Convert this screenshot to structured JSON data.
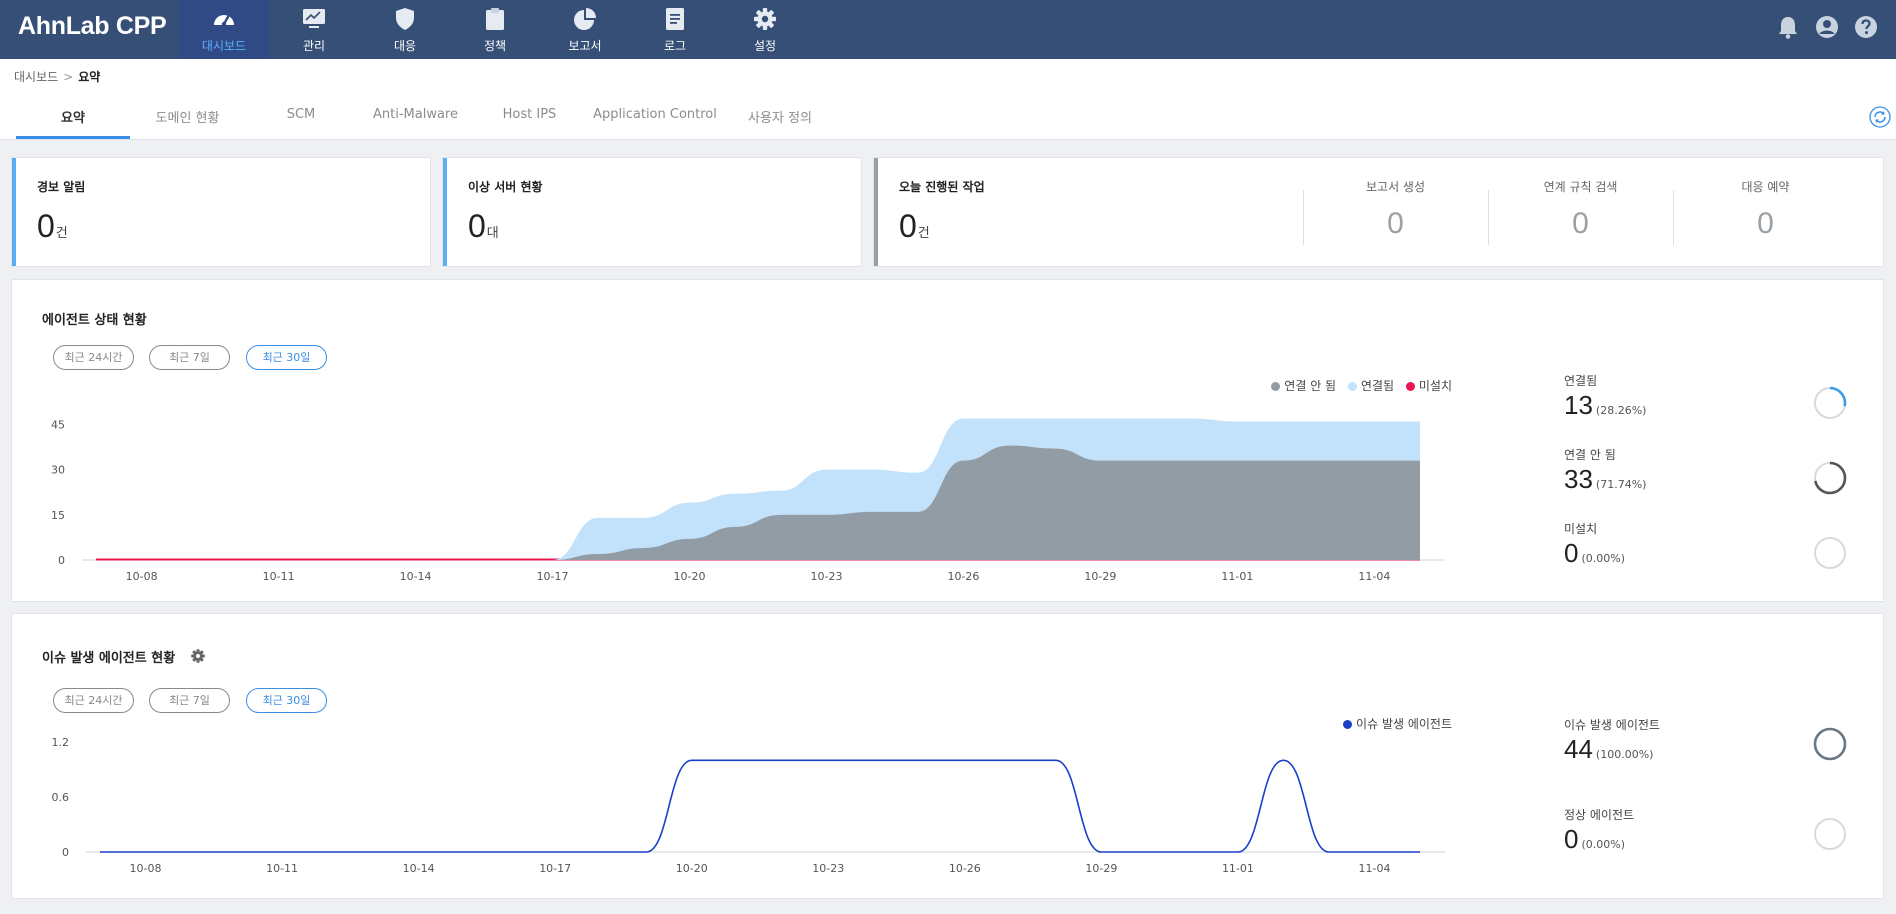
{
  "app": {
    "title": "AhnLab CPP"
  },
  "nav": {
    "items": [
      {
        "label": "대시보드",
        "icon": "speedometer-icon",
        "active": true
      },
      {
        "label": "관리",
        "icon": "monitor-icon"
      },
      {
        "label": "대응",
        "icon": "shield-icon"
      },
      {
        "label": "정책",
        "icon": "clipboard-icon"
      },
      {
        "label": "보고서",
        "icon": "pie-chart-icon"
      },
      {
        "label": "로그",
        "icon": "document-icon"
      },
      {
        "label": "설정",
        "icon": "gear-icon"
      }
    ]
  },
  "breadcrumb": {
    "root": "대시보드",
    "current": "요약"
  },
  "tabs": [
    "요약",
    "도메인 현황",
    "SCM",
    "Anti-Malware",
    "Host IPS",
    "Application Control",
    "사용자 정의"
  ],
  "cards": {
    "alerts": {
      "title": "경보 알림",
      "value": "0",
      "unit": "건"
    },
    "servers": {
      "title": "이상 서버 현황",
      "value": "0",
      "unit": "대"
    },
    "tasks": {
      "title": "오늘 진행된 작업",
      "value": "0",
      "unit": "건",
      "stats": [
        {
          "label": "보고서 생성",
          "value": "0"
        },
        {
          "label": "연계 규칙 검색",
          "value": "0"
        },
        {
          "label": "대응 예약",
          "value": "0"
        }
      ]
    }
  },
  "panels": {
    "agent_status": {
      "title": "에이전트 상태 현황",
      "ranges": [
        "최근 24시간",
        "최근 7일",
        "최근 30일"
      ],
      "active_range": 2,
      "legend": [
        "연결 안 됨",
        "연결됨",
        "미설치"
      ],
      "side": [
        {
          "label": "연결됨",
          "value": "13",
          "pct": "(28.26%)",
          "ratio": 0.2826,
          "color": "#3a9be8"
        },
        {
          "label": "연결 안 됨",
          "value": "33",
          "pct": "(71.74%)",
          "ratio": 0.7174,
          "color": "#555555"
        },
        {
          "label": "미설치",
          "value": "0",
          "pct": "(0.00%)",
          "ratio": 0,
          "color": "#cccccc"
        }
      ]
    },
    "issue_agents": {
      "title": "이슈 발생 에이전트 현황",
      "ranges": [
        "최근 24시간",
        "최근 7일",
        "최근 30일"
      ],
      "active_range": 2,
      "legend": [
        "이슈 발생 에이전트"
      ],
      "side": [
        {
          "label": "이슈 발생 에이전트",
          "value": "44",
          "pct": "(100.00%)",
          "ratio": 1,
          "color": "#6b7785"
        },
        {
          "label": "정상 에이전트",
          "value": "0",
          "pct": "(0.00%)",
          "ratio": 0,
          "color": "#cccccc"
        }
      ]
    }
  },
  "chart_data": [
    {
      "type": "area",
      "x": [
        "10-07",
        "10-08",
        "10-09",
        "10-10",
        "10-11",
        "10-12",
        "10-13",
        "10-14",
        "10-15",
        "10-16",
        "10-17",
        "10-18",
        "10-19",
        "10-20",
        "10-21",
        "10-22",
        "10-23",
        "10-24",
        "10-25",
        "10-26",
        "10-27",
        "10-28",
        "10-29",
        "10-30",
        "10-31",
        "11-01",
        "11-02",
        "11-03",
        "11-04",
        "11-05"
      ],
      "xticks": [
        "10-08",
        "10-11",
        "10-14",
        "10-17",
        "10-20",
        "10-23",
        "10-26",
        "10-29",
        "11-01",
        "11-04"
      ],
      "yticks": [
        0,
        15,
        30,
        45
      ],
      "ylim": [
        0,
        52
      ],
      "series": [
        {
          "name": "연결 안 됨",
          "color": "#929ca5",
          "values": [
            0,
            0,
            0,
            0,
            0,
            0,
            0,
            0,
            0,
            0,
            0,
            2,
            4,
            7,
            11,
            15,
            15,
            16,
            16,
            33,
            38,
            37,
            33,
            33,
            33,
            33,
            33,
            33,
            33,
            33
          ]
        },
        {
          "name": "연결됨",
          "color": "#c2e1fb",
          "values": [
            0,
            0,
            0,
            0,
            0,
            0,
            0,
            0,
            0,
            0,
            0,
            12,
            10,
            12,
            11,
            8,
            15,
            14,
            13,
            14,
            9,
            10,
            14,
            14,
            14,
            13,
            13,
            13,
            13,
            13
          ]
        },
        {
          "name": "미설치",
          "color": "#e8164d",
          "values": [
            0,
            0,
            0,
            0,
            0,
            0,
            0,
            0,
            0,
            0,
            0,
            0,
            0,
            0,
            0,
            0,
            0,
            0,
            0,
            0,
            0,
            0,
            0,
            0,
            0,
            0,
            0,
            0,
            0,
            0
          ]
        }
      ]
    },
    {
      "type": "line",
      "x": [
        "10-07",
        "10-08",
        "10-09",
        "10-10",
        "10-11",
        "10-12",
        "10-13",
        "10-14",
        "10-15",
        "10-16",
        "10-17",
        "10-18",
        "10-19",
        "10-20",
        "10-21",
        "10-22",
        "10-23",
        "10-24",
        "10-25",
        "10-26",
        "10-27",
        "10-28",
        "10-29",
        "10-30",
        "10-31",
        "11-01",
        "11-02",
        "11-03",
        "11-04",
        "11-05"
      ],
      "xticks": [
        "10-08",
        "10-11",
        "10-14",
        "10-17",
        "10-20",
        "10-23",
        "10-26",
        "10-29",
        "11-01",
        "11-04"
      ],
      "yticks": [
        0,
        0.6,
        1.2
      ],
      "ylim": [
        0,
        1.2
      ],
      "series": [
        {
          "name": "이슈 발생 에이전트",
          "color": "#1a3fc9",
          "values": [
            0,
            0,
            0,
            0,
            0,
            0,
            0,
            0,
            0,
            0,
            0,
            0,
            0,
            1,
            1,
            1,
            1,
            1,
            1,
            1,
            1,
            1,
            0,
            0,
            0,
            0,
            1,
            0,
            0,
            0
          ]
        }
      ]
    }
  ]
}
